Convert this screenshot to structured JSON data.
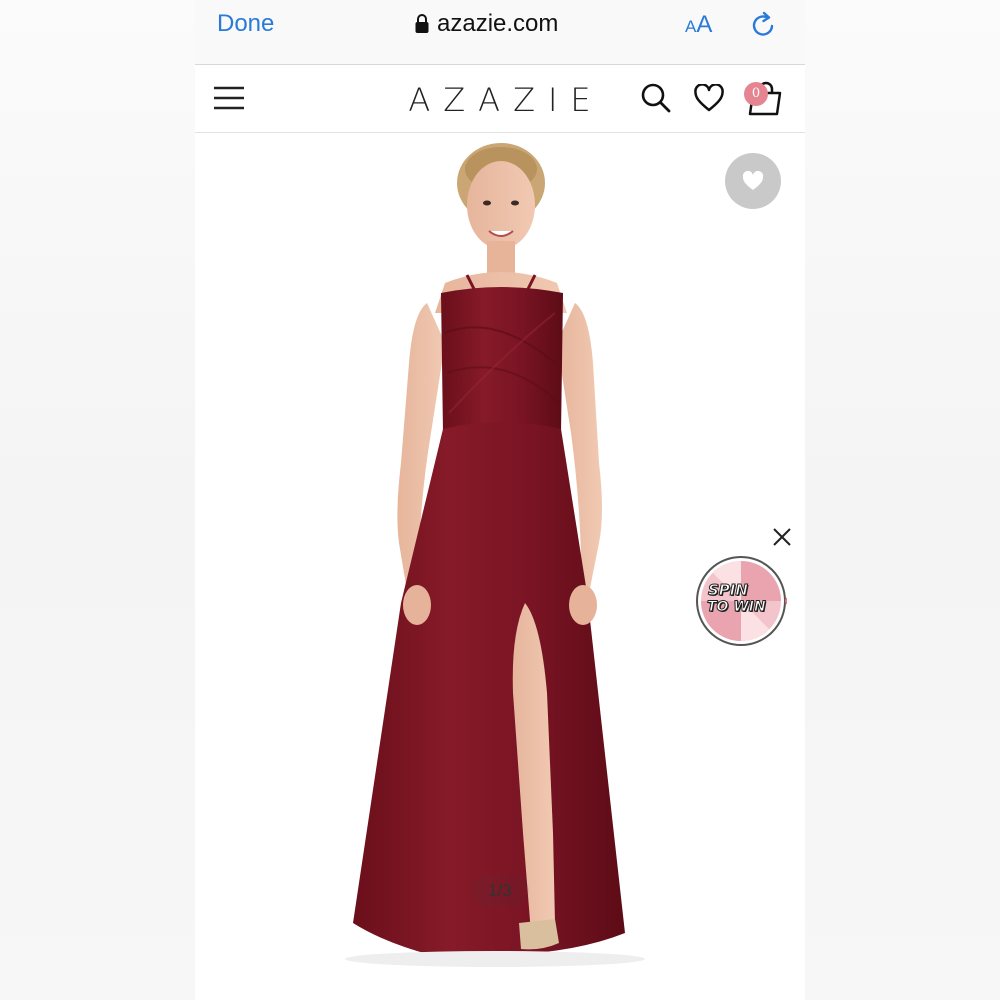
{
  "browser": {
    "done_label": "Done",
    "url": "azazie.com",
    "text_size_small": "A",
    "text_size_large": "A"
  },
  "header": {
    "brand": "AZAZIE",
    "cart_count": "0"
  },
  "gallery": {
    "pager": "1/3",
    "promo": {
      "line1": "SPIN",
      "line2": "TO WIN"
    }
  },
  "colors": {
    "link_blue": "#2a7ad9",
    "dress_burgundy": "#7e1422",
    "badge_pink": "#e48591"
  }
}
